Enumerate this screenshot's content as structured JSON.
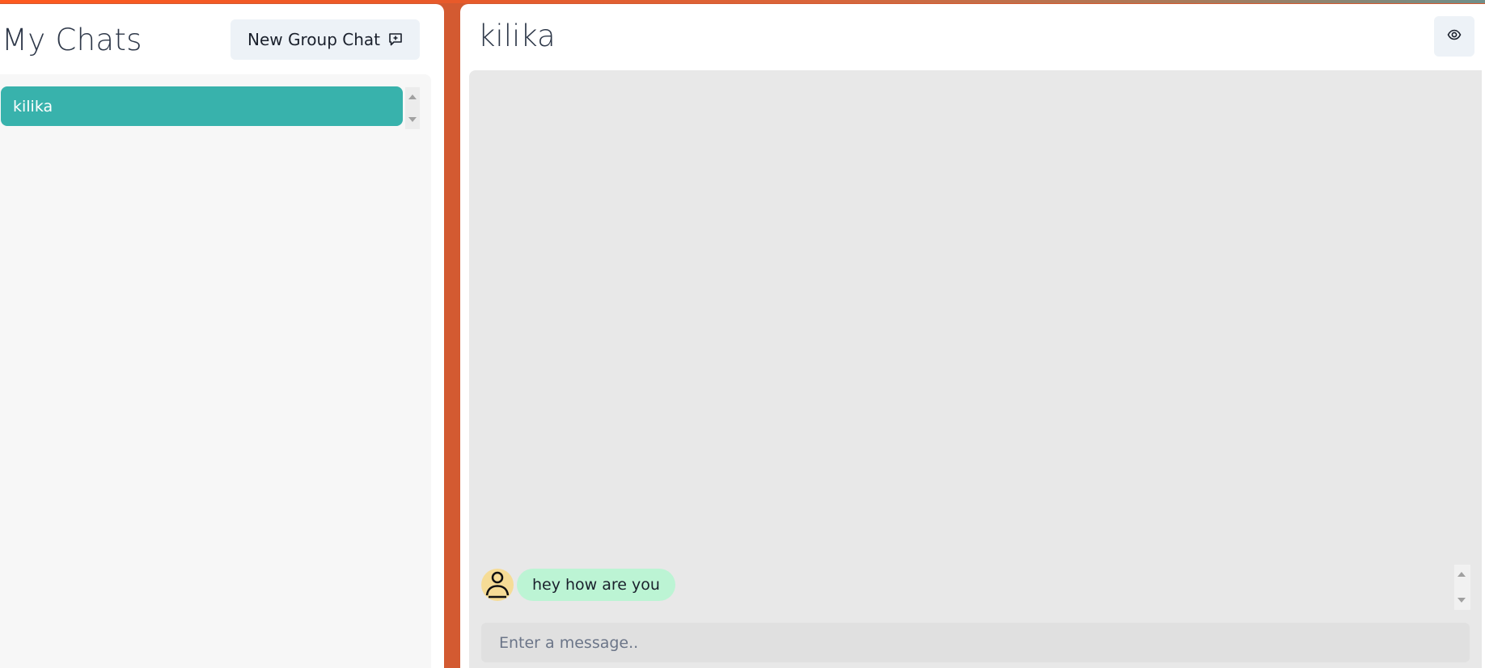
{
  "sidebar": {
    "title": "My Chats",
    "new_group_button": "New Group Chat",
    "chats": [
      {
        "name": "kilika",
        "selected": true
      }
    ]
  },
  "chat": {
    "title": "kilika",
    "messages": [
      {
        "text": "hey how are you",
        "sender": "other"
      }
    ],
    "input_placeholder": "Enter a message.."
  },
  "icons": {
    "new_group": "chat-plus-icon",
    "view_profile": "eye-icon",
    "avatar": "user-icon"
  },
  "colors": {
    "accent": "#38b2ac",
    "bubble": "#bcf4d4",
    "background": "#d35a31"
  }
}
